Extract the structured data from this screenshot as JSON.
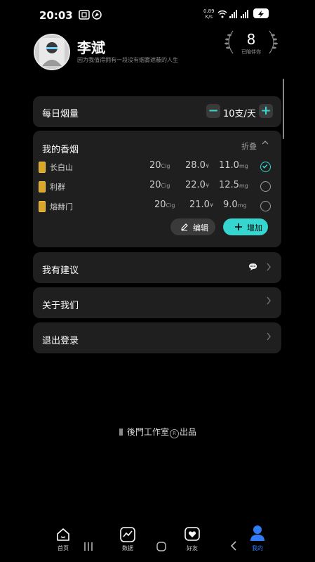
{
  "status_bar": {
    "time": "20:03",
    "net_speed_value": "0.89",
    "net_speed_unit": "K/s"
  },
  "profile": {
    "name": "李斌",
    "motto": "因为我值得拥有一段没有烟雾遮蔽的人生",
    "days_count": "8",
    "days_label": "已陪伴你"
  },
  "daily": {
    "title": "每日烟量",
    "value": "10支/天",
    "minus": "−",
    "plus": "+"
  },
  "my_cigs": {
    "title": "我的香烟",
    "fold_label": "折叠",
    "rows": [
      {
        "name": "长白山",
        "count": "20",
        "count_unit": "Cig",
        "price": "28.0",
        "price_unit": "¥",
        "tar": "11.0",
        "tar_unit": "mg",
        "selected": true
      },
      {
        "name": "利群",
        "count": "20",
        "count_unit": "Cig",
        "price": "22.0",
        "price_unit": "¥",
        "tar": "12.5",
        "tar_unit": "mg",
        "selected": false
      },
      {
        "name": "熔赫门",
        "count": "20",
        "count_unit": "Cig",
        "price": "21.0",
        "price_unit": "¥",
        "tar": "9.0",
        "tar_unit": "mg",
        "selected": false
      }
    ],
    "edit_label": "编辑",
    "add_label": "增加"
  },
  "menu": {
    "suggest": "我有建议",
    "about": "关于我们",
    "logout": "退出登录"
  },
  "footer": {
    "brand": "後門工作室",
    "suffix": "出品"
  },
  "nav": {
    "home": "首页",
    "data": "数据",
    "friends": "好友",
    "mine": "我的"
  },
  "colors": {
    "accent": "#36d6d0",
    "nav_active": "#2f7cf6",
    "card_bg": "#1f1f1f"
  }
}
